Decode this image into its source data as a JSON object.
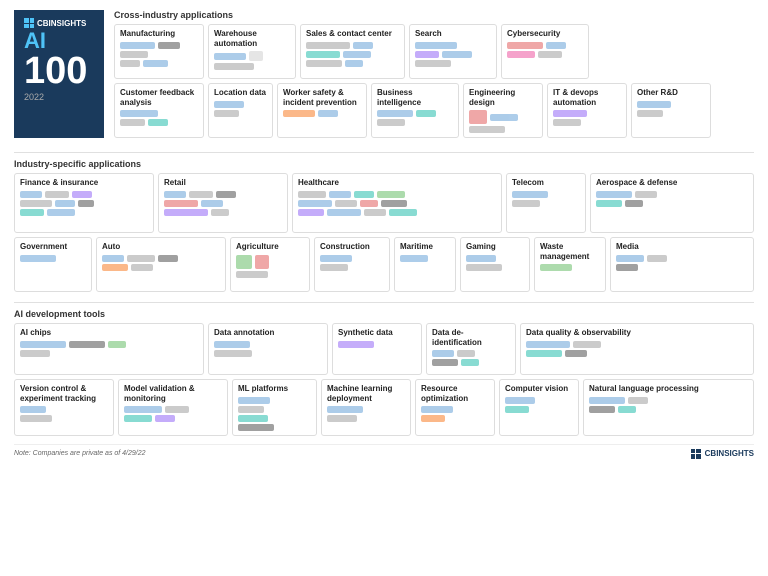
{
  "header": {
    "brand": "CBINSIGHTS",
    "ai_label": "AI",
    "number": "100",
    "year": "2022"
  },
  "sections": {
    "cross_industry": {
      "title": "Cross-industry applications",
      "cards": [
        {
          "id": "manufacturing",
          "label": "Manufacturing",
          "width": "md"
        },
        {
          "id": "warehouse-automation",
          "label": "Warehouse automation",
          "width": "md"
        },
        {
          "id": "sales-contact",
          "label": "Sales & contact center",
          "width": "lg"
        },
        {
          "id": "search",
          "label": "Search",
          "width": "md"
        },
        {
          "id": "cybersecurity",
          "label": "Cybersecurity",
          "width": "md"
        },
        {
          "id": "customer-feedback",
          "label": "Customer feedback analysis",
          "width": "md"
        },
        {
          "id": "location-data",
          "label": "Location data",
          "width": "sm"
        },
        {
          "id": "worker-safety",
          "label": "Worker safety & incident prevention",
          "width": "md"
        },
        {
          "id": "business-intel",
          "label": "Business intelligence",
          "width": "md"
        },
        {
          "id": "engineering-design",
          "label": "Engineering design",
          "width": "md"
        },
        {
          "id": "it-devops",
          "label": "IT & devops automation",
          "width": "md"
        },
        {
          "id": "other-rd",
          "label": "Other R&D",
          "width": "md"
        }
      ]
    },
    "industry_specific": {
      "title": "Industry-specific applications",
      "row1": [
        {
          "id": "finance",
          "label": "Finance & insurance"
        },
        {
          "id": "retail",
          "label": "Retail"
        },
        {
          "id": "healthcare",
          "label": "Healthcare"
        },
        {
          "id": "telecom",
          "label": "Telecom"
        },
        {
          "id": "aerospace",
          "label": "Aerospace & defense"
        }
      ],
      "row2": [
        {
          "id": "government",
          "label": "Government"
        },
        {
          "id": "auto",
          "label": "Auto"
        },
        {
          "id": "agriculture",
          "label": "Agriculture"
        },
        {
          "id": "construction",
          "label": "Construction"
        },
        {
          "id": "maritime",
          "label": "Maritime"
        },
        {
          "id": "gaming",
          "label": "Gaming"
        },
        {
          "id": "waste-mgmt",
          "label": "Waste management"
        },
        {
          "id": "media",
          "label": "Media"
        }
      ]
    },
    "ai_dev_tools": {
      "title": "AI development tools",
      "row1": [
        {
          "id": "ai-chips",
          "label": "AI chips"
        },
        {
          "id": "data-annotation",
          "label": "Data annotation"
        },
        {
          "id": "synthetic-data",
          "label": "Synthetic data"
        },
        {
          "id": "data-deident",
          "label": "Data de-identification"
        },
        {
          "id": "data-quality",
          "label": "Data quality & observability"
        }
      ],
      "row2": [
        {
          "id": "version-control",
          "label": "Version control & experiment tracking"
        },
        {
          "id": "model-validation",
          "label": "Model validation & monitoring"
        },
        {
          "id": "ml-platforms",
          "label": "ML platforms"
        },
        {
          "id": "ml-deployment",
          "label": "Machine learning deployment"
        },
        {
          "id": "resource-opt",
          "label": "Resource optimization"
        },
        {
          "id": "computer-vision",
          "label": "Computer vision"
        },
        {
          "id": "nlp",
          "label": "Natural language processing"
        }
      ]
    }
  },
  "footer": {
    "note": "Note: Companies are private as of 4/29/22",
    "brand": "CBINSIGHTS"
  }
}
